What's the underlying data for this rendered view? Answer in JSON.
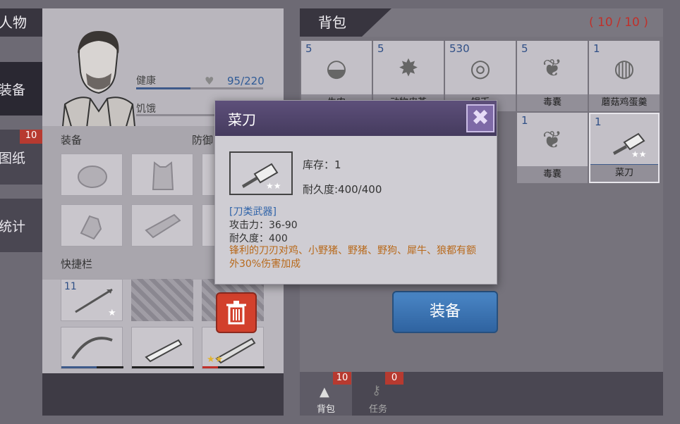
{
  "nav": {
    "character": "人物",
    "equip": "装备",
    "blueprint": "图纸",
    "blueprint_badge": "10",
    "stats": "统计"
  },
  "character": {
    "health_label": "健康",
    "health_value": "95/220",
    "hunger_label": "饥饿",
    "health_fraction": 0.43,
    "equipment_label": "装备",
    "defense_label": "防御",
    "quickbar_label": "快捷栏",
    "quick_count": "11"
  },
  "bag": {
    "title": "背包",
    "capacity": "( 10 / 10 )",
    "items": [
      {
        "qty": "5",
        "name": "牛肉",
        "icon": "meat-icon"
      },
      {
        "qty": "5",
        "name": "动物皮革",
        "icon": "hide-icon"
      },
      {
        "qty": "530",
        "name": "银币",
        "icon": "coin-icon"
      },
      {
        "qty": "5",
        "name": "毒囊",
        "icon": "poison-sac-icon"
      },
      {
        "qty": "1",
        "name": "蘑菇鸡蛋羹",
        "icon": "mushroom-soup-icon"
      },
      {
        "qty": "1",
        "name": "毒囊",
        "icon": "poison-sac-icon"
      },
      {
        "qty": "1",
        "name": "菜刀",
        "icon": "cleaver-icon"
      }
    ],
    "bottom_tabs": [
      {
        "label": "背包",
        "badge": "10"
      },
      {
        "label": "任务",
        "badge": "0"
      }
    ]
  },
  "popup": {
    "title": "菜刀",
    "stock": "库存：1",
    "durability_header": "耐久度:400/400",
    "category": "[刀类武器]",
    "attack": "攻击力：36-90",
    "durability": "耐久度：400",
    "description": "锋利的刀刃对鸡、小野猪、野猪、野狗、犀牛、狼都有额外30%伤害加成",
    "equip_button": "装备"
  },
  "colors": {
    "accent_blue": "#3f78b8",
    "capacity_red": "#c0302a",
    "description_orange": "#b8691a",
    "category_blue": "#2e62a8",
    "delete_red": "#d2402c"
  }
}
